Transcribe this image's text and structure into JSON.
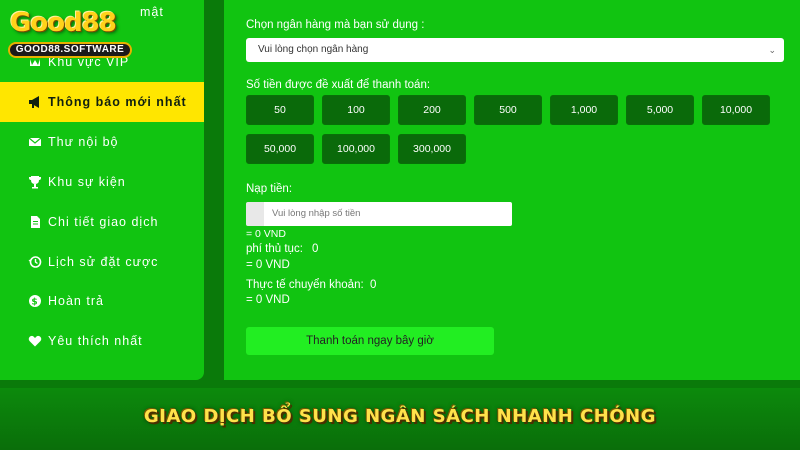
{
  "logo": {
    "brand": "Good88",
    "domain": "GOOD88.SOFTWARE"
  },
  "sidebar": {
    "items": [
      {
        "label": "mật",
        "icon": "user-icon"
      },
      {
        "label": "Khu vực VIP",
        "icon": "vip-icon",
        "badge": "VIP"
      },
      {
        "label": "Thông báo mới nhất",
        "icon": "megaphone-icon",
        "active": true
      },
      {
        "label": "Thư nội bộ",
        "icon": "mail-icon"
      },
      {
        "label": "Khu sự kiện",
        "icon": "trophy-icon"
      },
      {
        "label": "Chi tiết giao dịch",
        "icon": "document-icon"
      },
      {
        "label": "Lịch sử đặt cược",
        "icon": "history-icon"
      },
      {
        "label": "Hoàn trả",
        "icon": "coin-icon"
      },
      {
        "label": "Yêu thích nhất",
        "icon": "heart-icon"
      }
    ]
  },
  "form": {
    "bank_label": "Chọn ngân hàng mà bạn sử dụng :",
    "bank_select_value": "Vui lòng chọn ngân hàng",
    "suggest_label": "Số tiền được đề xuất để thanh toán:",
    "amounts": [
      "50",
      "100",
      "200",
      "500",
      "1,000",
      "5,000",
      "10,000",
      "50,000",
      "100,000",
      "300,000"
    ],
    "deposit_label": "Nạp tiền:",
    "deposit_placeholder": "Vui lòng nhập số tiền",
    "deposit_equiv": "= 0 VND",
    "fee_label": "phí thủ tục:",
    "fee_value": "0",
    "fee_equiv": "= 0 VND",
    "actual_label": "Thực tế chuyển khoản:",
    "actual_value": "0",
    "actual_equiv": "= 0 VND",
    "pay_button": "Thanh toán ngay bây giờ"
  },
  "caption": "GIAO DỊCH BỔ SUNG NGÂN SÁCH NHANH CHÓNG",
  "colors": {
    "panel_green": "#11c411",
    "active_yellow": "#ffe600",
    "amount_dark_green": "#0a6a0a",
    "pay_button_green": "#22ee22",
    "caption_yellow": "#ffe24a"
  }
}
